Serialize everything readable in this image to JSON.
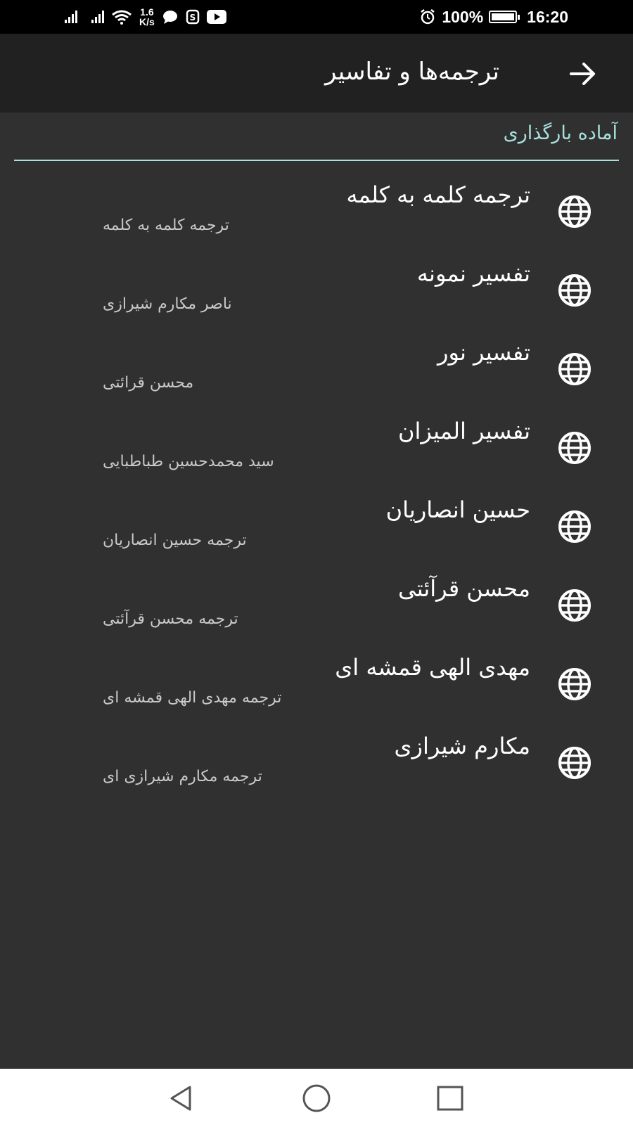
{
  "status_bar": {
    "net_speed_value": "1.6",
    "net_speed_unit": "K/s",
    "battery_level": "100%",
    "battery_fraction": 1.0,
    "time": "16:20",
    "icons": [
      "signal-icon",
      "signal-icon",
      "wifi-icon",
      "chat-icon",
      "sim-icon",
      "youtube-icon",
      "alarm-icon",
      "battery-charging-icon"
    ]
  },
  "app_bar": {
    "title": "ترجمه‌ها و تفاسیر",
    "back_icon": "arrow-right-icon"
  },
  "section": {
    "header": "آماده بارگذاری",
    "accent_color": "#a6e0dc"
  },
  "items": [
    {
      "title": "ترجمه کلمه به کلمه",
      "subtitle": "ترجمه کلمه به کلمه",
      "icon": "globe-icon"
    },
    {
      "title": "تفسیر نمونه",
      "subtitle": "ناصر مکارم شیرازی",
      "icon": "globe-icon"
    },
    {
      "title": "تفسیر نور",
      "subtitle": "محسن قرائتی",
      "icon": "globe-icon"
    },
    {
      "title": "تفسیر المیزان",
      "subtitle": "سید محمدحسین طباطبایی",
      "icon": "globe-icon"
    },
    {
      "title": "حسین انصاریان",
      "subtitle": "ترجمه حسین انصاریان",
      "icon": "globe-icon"
    },
    {
      "title": "محسن قرآئتی",
      "subtitle": "ترجمه محسن قرآئتی",
      "icon": "globe-icon"
    },
    {
      "title": "مهدی الهی قمشه ای",
      "subtitle": "ترجمه مهدی الهی قمشه ای",
      "icon": "globe-icon"
    },
    {
      "title": "مکارم شیرازی",
      "subtitle": "ترجمه مکارم شیرازی ای",
      "icon": "globe-icon"
    }
  ],
  "nav_bar": {
    "buttons": [
      "back-triangle-icon",
      "home-circle-icon",
      "recents-square-icon"
    ]
  },
  "colors": {
    "background": "#303030",
    "app_bar": "#212121",
    "status_bar": "#000000",
    "nav_bar": "#ffffff"
  }
}
